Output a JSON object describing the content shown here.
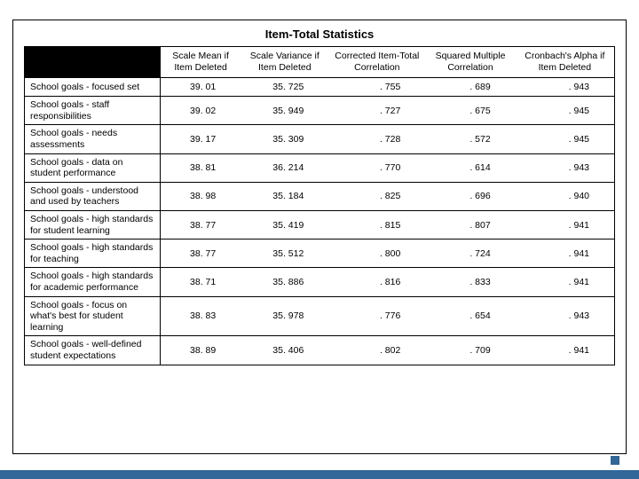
{
  "title": "Item-Total Statistics",
  "headers": {
    "c0": "",
    "c1": "Scale Mean if Item Deleted",
    "c2": "Scale Variance if Item Deleted",
    "c3": "Corrected Item-Total Correlation",
    "c4": "Squared Multiple Correlation",
    "c5": "Cronbach's Alpha if Item Deleted"
  },
  "rows": [
    {
      "label": "School goals - focused set",
      "mean": "39. 01",
      "var": "35. 725",
      "corr": ". 755",
      "sq": ". 689",
      "alpha": ". 943"
    },
    {
      "label": "School goals - staff responsibilities",
      "mean": "39. 02",
      "var": "35. 949",
      "corr": ". 727",
      "sq": ". 675",
      "alpha": ". 945"
    },
    {
      "label": "School goals - needs assessments",
      "mean": "39. 17",
      "var": "35. 309",
      "corr": ". 728",
      "sq": ". 572",
      "alpha": ". 945"
    },
    {
      "label": "School goals - data on student performance",
      "mean": "38. 81",
      "var": "36. 214",
      "corr": ". 770",
      "sq": ". 614",
      "alpha": ". 943"
    },
    {
      "label": "School goals - understood and used by teachers",
      "mean": "38. 98",
      "var": "35. 184",
      "corr": ". 825",
      "sq": ". 696",
      "alpha": ". 940"
    },
    {
      "label": "School goals - high standards for student learning",
      "mean": "38. 77",
      "var": "35. 419",
      "corr": ". 815",
      "sq": ". 807",
      "alpha": ". 941"
    },
    {
      "label": "School goals - high standards for teaching",
      "mean": "38. 77",
      "var": "35. 512",
      "corr": ". 800",
      "sq": ". 724",
      "alpha": ". 941"
    },
    {
      "label": "School goals - high standards for academic performance",
      "mean": "38. 71",
      "var": "35. 886",
      "corr": ". 816",
      "sq": ". 833",
      "alpha": ". 941"
    },
    {
      "label": "School goals - focus on what's best for student learning",
      "mean": "38. 83",
      "var": "35. 978",
      "corr": ". 776",
      "sq": ". 654",
      "alpha": ". 943"
    },
    {
      "label": "School goals - well-defined student expectations",
      "mean": "38. 89",
      "var": "35. 406",
      "corr": ". 802",
      "sq": ". 709",
      "alpha": ". 941"
    }
  ]
}
